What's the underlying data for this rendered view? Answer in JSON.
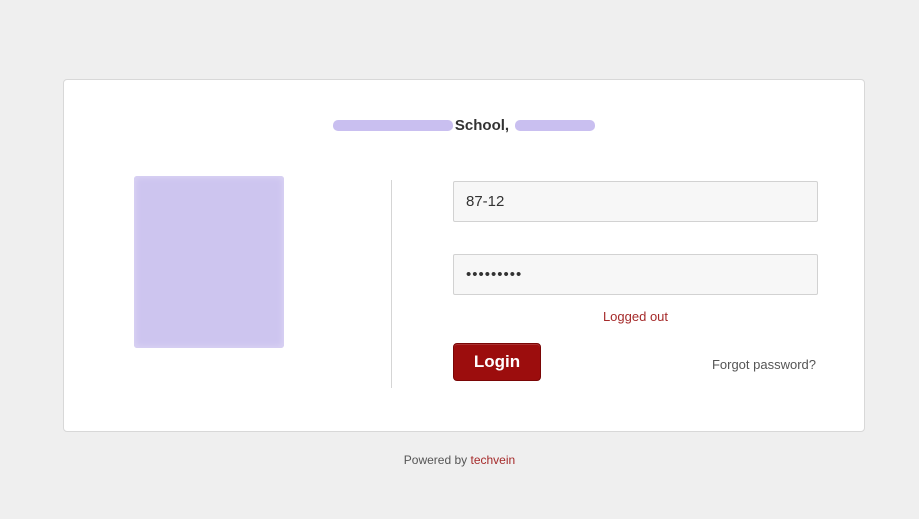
{
  "header": {
    "school_label": "School,"
  },
  "form": {
    "username_value": "87-12",
    "password_value": "•••••••••",
    "status_message": "Logged out",
    "login_label": "Login",
    "forgot_label": "Forgot password?"
  },
  "footer": {
    "powered_by": "Powered by",
    "brand": "techvein"
  },
  "colors": {
    "accent": "#9c0d0d",
    "status": "#a52a2a",
    "redaction": "#c9bff0"
  }
}
